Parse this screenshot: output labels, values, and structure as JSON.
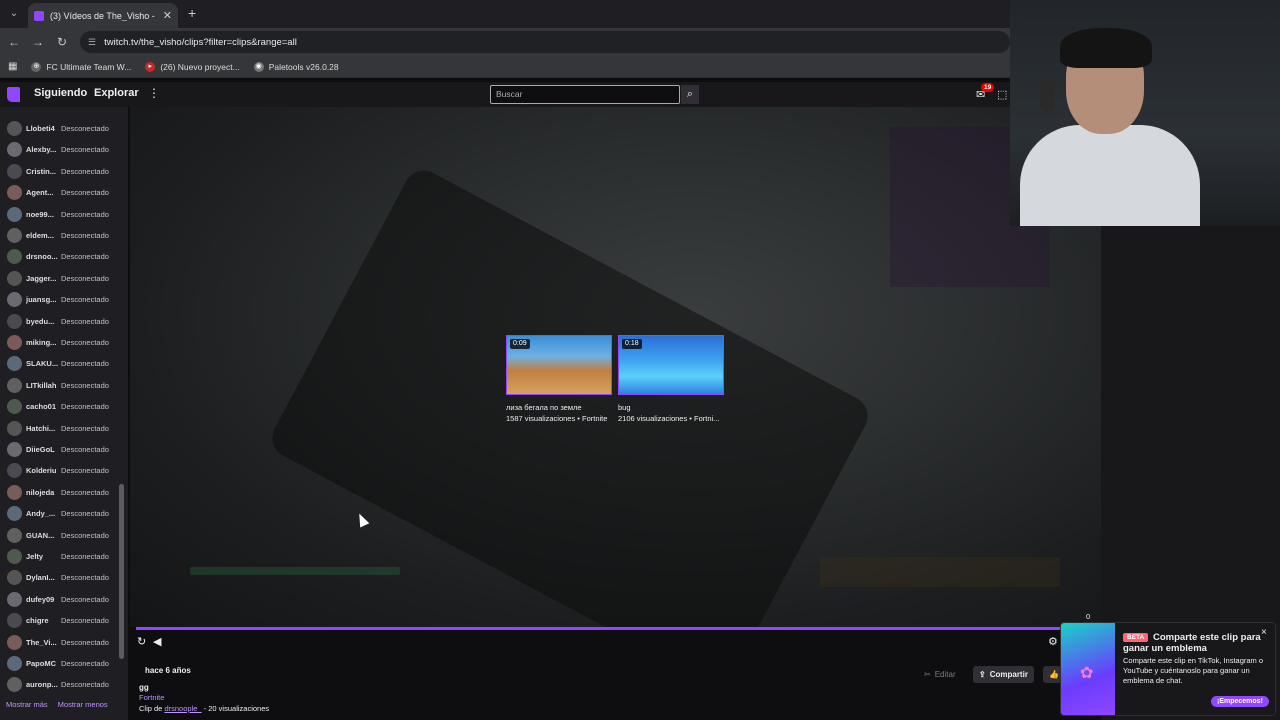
{
  "browser": {
    "tab_title": "(3) Vídeos de The_Visho - Twitch",
    "tab_close": "✕",
    "new_tab": "+",
    "url": "twitch.tv/the_visho/clips?filter=clips&range=all",
    "bookmarks": [
      {
        "label": "FC Ultimate Team W..."
      },
      {
        "label": "(26) Nuevo proyect..."
      },
      {
        "label": "Paletools v26.0.28"
      }
    ]
  },
  "topnav": {
    "following": "Siguiendo",
    "browse": "Explorar",
    "search_placeholder": "Buscar",
    "notifications_count": "19"
  },
  "sidebar": {
    "channels": [
      {
        "name": "Llobeti4",
        "status": "Desconectado"
      },
      {
        "name": "Alexby...",
        "status": "Desconectado"
      },
      {
        "name": "Cristin...",
        "status": "Desconectado"
      },
      {
        "name": "Agent...",
        "status": "Desconectado"
      },
      {
        "name": "noe99...",
        "status": "Desconectado"
      },
      {
        "name": "eldem...",
        "status": "Desconectado"
      },
      {
        "name": "drsnoo...",
        "status": "Desconectado"
      },
      {
        "name": "Jagger...",
        "status": "Desconectado"
      },
      {
        "name": "juansg...",
        "status": "Desconectado"
      },
      {
        "name": "byedu...",
        "status": "Desconectado"
      },
      {
        "name": "miking...",
        "status": "Desconectado"
      },
      {
        "name": "SLAKU...",
        "status": "Desconectado"
      },
      {
        "name": "LITkillah",
        "status": "Desconectado"
      },
      {
        "name": "cacho01",
        "status": "Desconectado"
      },
      {
        "name": "Hatchi...",
        "status": "Desconectado"
      },
      {
        "name": "DiieGoL",
        "status": "Desconectado"
      },
      {
        "name": "Kolderiu",
        "status": "Desconectado"
      },
      {
        "name": "nilojeda",
        "status": "Desconectado"
      },
      {
        "name": "Andy_...",
        "status": "Desconectado"
      },
      {
        "name": "GUAN...",
        "status": "Desconectado"
      },
      {
        "name": "Jelty",
        "status": "Desconectado"
      },
      {
        "name": "DylanI...",
        "status": "Desconectado"
      },
      {
        "name": "dufey09",
        "status": "Desconectado"
      },
      {
        "name": "chigre",
        "status": "Desconectado"
      },
      {
        "name": "The_Vi...",
        "status": "Desconectado"
      },
      {
        "name": "PapoMC",
        "status": "Desconectado"
      },
      {
        "name": "auronp...",
        "status": "Desconectado"
      }
    ],
    "show_more": "Mostrar más",
    "show_less": "Mostrar menos"
  },
  "player": {
    "related_clips": [
      {
        "duration": "0:09",
        "title": "лиза бегала по земле",
        "meta": "1587 visualizaciones • Fortnite"
      },
      {
        "duration": "0:18",
        "title": "bug",
        "meta": "2106 visualizaciones • Fortni..."
      }
    ],
    "counter": "0",
    "progress": 1.0
  },
  "clip_info": {
    "ago": "hace 6 años",
    "title": "gg",
    "game": "Fortnite",
    "clip_by_prefix": "Clip de",
    "clip_by_user": "drsnoople_",
    "views": "- 20 visualizaciones",
    "edit_label": "Editar",
    "share_label": "Compartir"
  },
  "toast": {
    "beta": "BETA",
    "heading": "Comparte este clip para ganar un emblema",
    "body": "Comparte este clip en TikTok, Instagram o YouTube y cuéntanoslo para ganar un emblema de chat.",
    "cta": "¡Empecemos!",
    "close": "×"
  },
  "colors": {
    "accent": "#9146ff",
    "link": "#bf94ff",
    "background": "#0e0e10"
  }
}
